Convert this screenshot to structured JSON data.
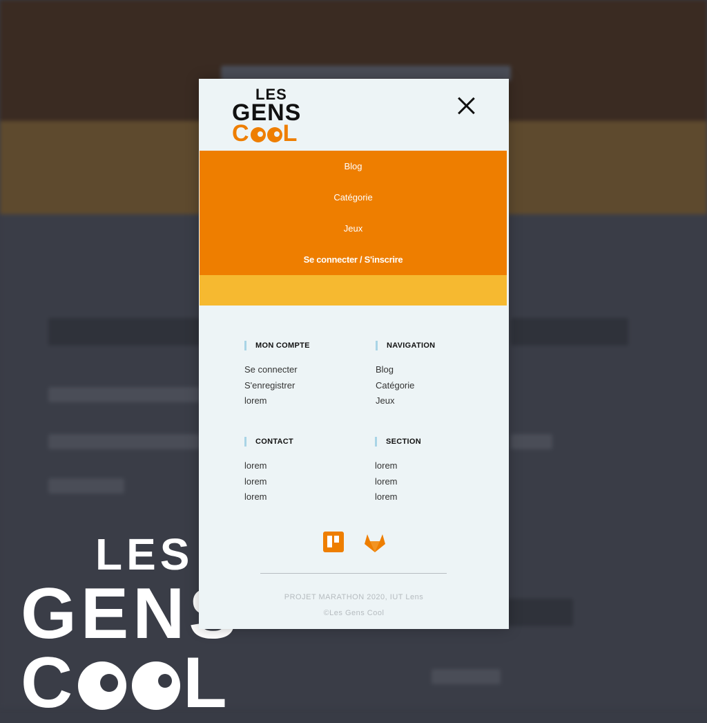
{
  "watermark": {
    "line1": "LES",
    "line2": "GENS",
    "line3_prefix": "C",
    "line3_suffix": "L"
  },
  "logo": {
    "line1": "LES",
    "line2": "GENS",
    "line3_prefix": "C",
    "line3_suffix": "L"
  },
  "menu": {
    "items": [
      {
        "label": "Blog"
      },
      {
        "label": "Catégorie"
      },
      {
        "label": "Jeux"
      },
      {
        "label": "Se connecter / S'inscrire"
      }
    ]
  },
  "footer_cols": [
    {
      "title": "MON COMPTE",
      "links": [
        "Se connecter",
        "S'enregistrer",
        "lorem"
      ]
    },
    {
      "title": "NAVIGATION",
      "links": [
        "Blog",
        "Catégorie",
        "Jeux"
      ]
    },
    {
      "title": "CONTACT",
      "links": [
        "lorem",
        "lorem",
        "lorem"
      ]
    },
    {
      "title": "SECTION",
      "links": [
        "lorem",
        "lorem",
        "lorem"
      ]
    }
  ],
  "social": [
    "trello-icon",
    "gitlab-icon"
  ],
  "footer": {
    "line1": "PROJET MARATHON 2020, IUT Lens",
    "line2": "©Les Gens Cool"
  },
  "colors": {
    "accent_orange": "#ee7e00",
    "accent_yellow": "#f6b930",
    "modal_bg": "#edf4f6",
    "title_bar": "#a9d4e6"
  }
}
